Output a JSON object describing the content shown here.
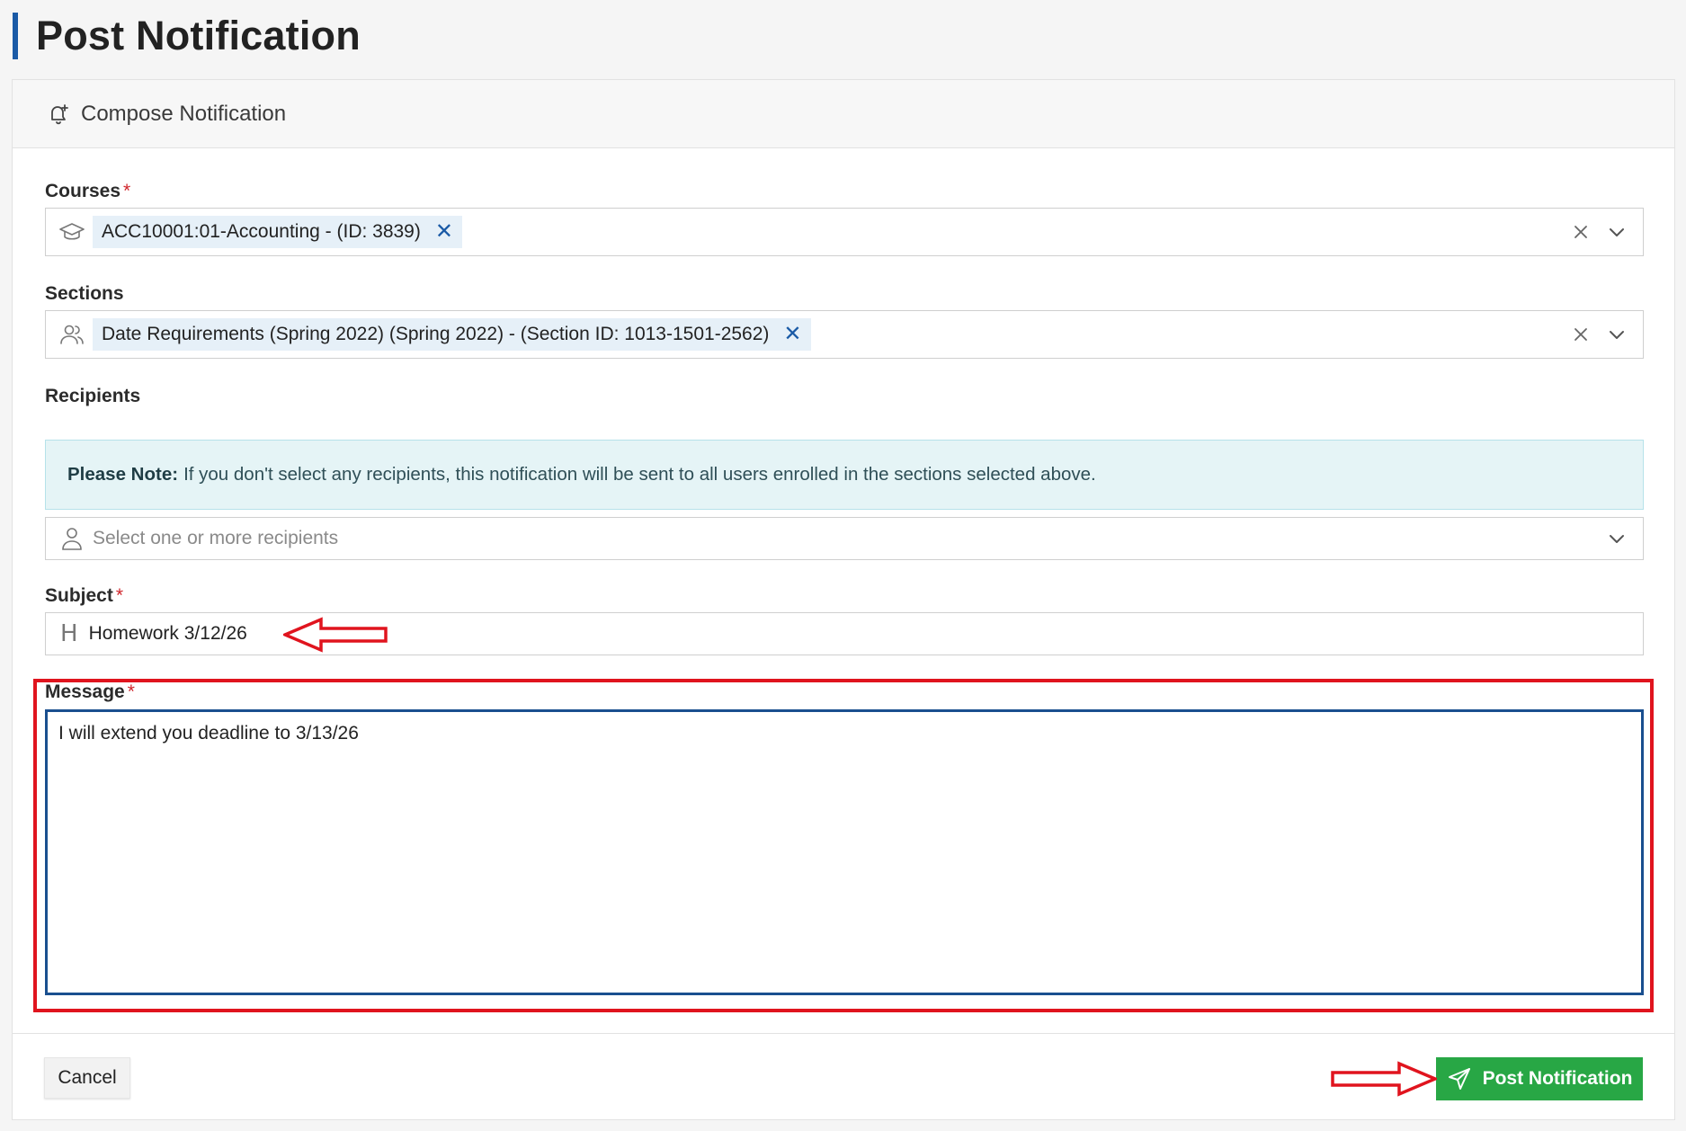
{
  "page": {
    "title": "Post Notification"
  },
  "card": {
    "header_title": "Compose Notification"
  },
  "courses": {
    "label": "Courses",
    "required_mark": "*",
    "tag": "ACC10001:01-Accounting - (ID: 3839)",
    "tag_remove": "✕"
  },
  "sections": {
    "label": "Sections",
    "tag": "Date Requirements (Spring 2022) (Spring 2022) - (Section ID: 1013-1501-2562)",
    "tag_remove": "✕"
  },
  "recipients": {
    "label": "Recipients",
    "note_bold": "Please Note:",
    "note_text": "If you don't select any recipients, this notification will be sent to all users enrolled in the sections selected above.",
    "placeholder": "Select one or more recipients"
  },
  "subject": {
    "label": "Subject",
    "required_mark": "*",
    "value": "Homework 3/12/26"
  },
  "message": {
    "label": "Message",
    "required_mark": "*",
    "value": "I will extend you deadline to 3/13/26"
  },
  "footer": {
    "cancel_label": "Cancel",
    "post_label": "Post Notification"
  },
  "colors": {
    "accent_blue": "#1a5aa6",
    "success_green": "#28a745",
    "annotation_red": "#e0141e",
    "note_bg": "#e5f4f6"
  },
  "icons": {
    "header": "bell-plus-icon",
    "courses": "graduation-cap-icon",
    "sections": "users-icon",
    "recipients": "user-icon",
    "subject": "heading-icon",
    "post": "send-icon",
    "clear": "close-icon",
    "dropdown": "chevron-down-icon"
  }
}
